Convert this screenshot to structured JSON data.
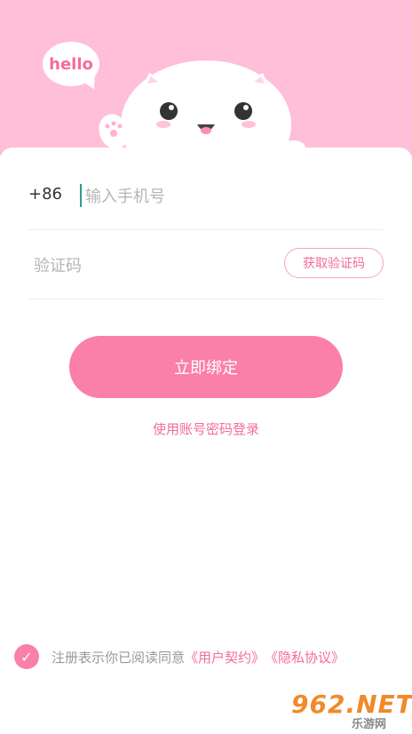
{
  "header": {
    "bubble_text": "hello"
  },
  "form": {
    "country_code": "+86",
    "phone_placeholder": "输入手机号",
    "code_placeholder": "验证码",
    "get_code_label": "获取验证码",
    "bind_label": "立即绑定",
    "password_login_label": "使用账号密码登录"
  },
  "agreement": {
    "text": "注册表示你已阅读同意",
    "user_agreement": "《用户契约》",
    "privacy_agreement": "《隐私协议》",
    "checked": true
  },
  "watermark": {
    "logo": "962.NET",
    "sub": "乐游网"
  },
  "colors": {
    "brand_pink": "#fa7fa9",
    "link_pink": "#f46b9d",
    "header_bg": "#ffbfd8"
  }
}
